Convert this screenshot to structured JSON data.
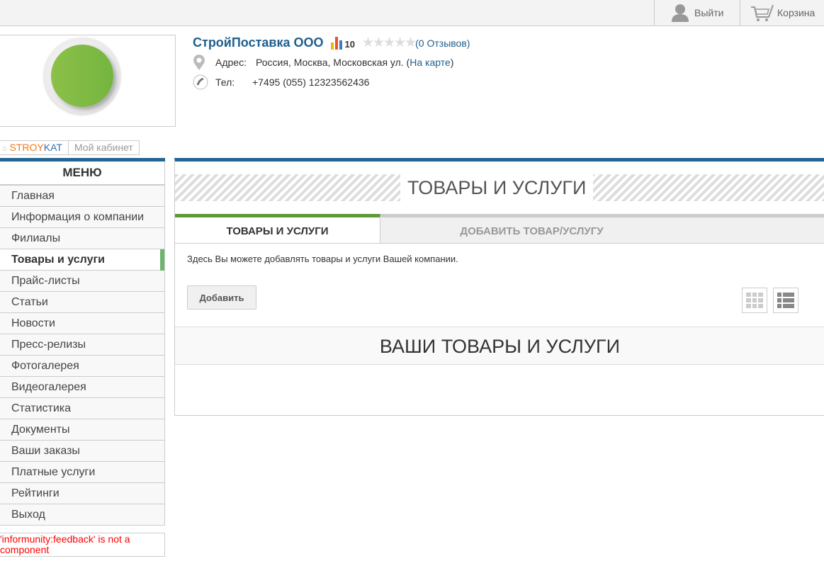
{
  "topbar": {
    "logout": "Выйти",
    "cart": "Корзина"
  },
  "company": {
    "name": "СтройПоставка ООО",
    "rating": "10",
    "reviews": "(0 Отзывов)",
    "address_label": "Адрес:",
    "address": "Россия, Москва, Московская ул. (",
    "map_link": "На карте",
    "address_end": ")",
    "phone_label": "Тел:",
    "phone": "+7495 (055) 12323562436"
  },
  "breadcrumb": {
    "home_a": "STROY",
    "home_b": "KAT",
    "current": "Мой кабинет"
  },
  "menu": {
    "title": "МЕНЮ",
    "items": [
      "Главная",
      "Информация о компании",
      "Филиалы",
      "Товары и услуги",
      "Прайс-листы",
      "Статьи",
      "Новости",
      "Пресс-релизы",
      "Фотогалерея",
      "Видеогалерея",
      "Статистика",
      "Документы",
      "Ваши заказы",
      "Платные услуги",
      "Рейтинги",
      "Выход"
    ],
    "active": 3
  },
  "error": "'informunity:feedback' is not a component",
  "main": {
    "title": "ТОВАРЫ И УСЛУГИ",
    "tabs": [
      "ТОВАРЫ И УСЛУГИ",
      "ДОБАВИТЬ ТОВАР/УСЛУГУ"
    ],
    "description": "Здесь Вы можете добавлять товары и услуги Вашей компании.",
    "add_button": "Добавить",
    "section_title": "ВАШИ ТОВАРЫ И УСЛУГИ"
  }
}
